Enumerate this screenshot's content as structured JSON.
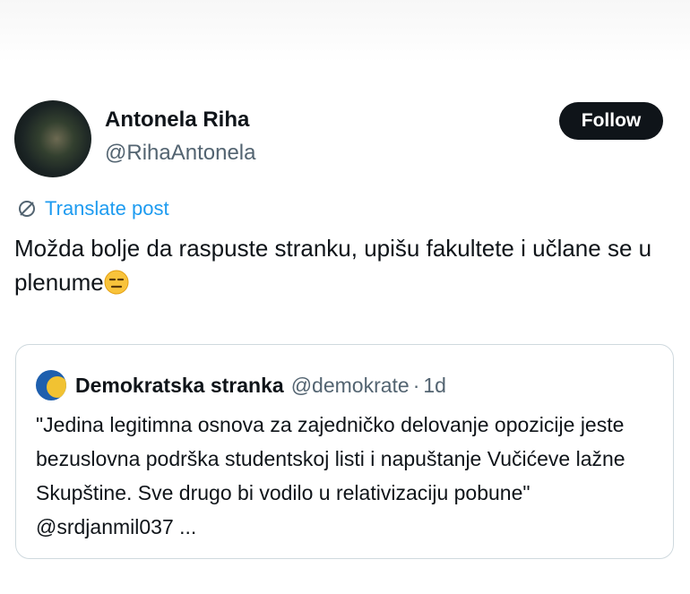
{
  "post": {
    "author": {
      "name": "Antonela Riha",
      "handle": "@RihaAntonela"
    },
    "follow_label": "Follow",
    "translate_label": "Translate post",
    "text": "Možda bolje da raspuste stranku, upišu fakultete i učlane se u plenume",
    "emoji": "expressionless-face"
  },
  "quote": {
    "author_name": "Demokratska stranka",
    "author_handle": "@demokrate",
    "separator": "·",
    "time": "1d",
    "text": "\"Jedina legitimna osnova za zajedničko delovanje opozicije jeste bezuslovna podrška studentskoj listi i napuštanje Vučićeve lažne Skupštine. Sve drugo bi vodilo u relativizaciju pobune\" @srdjanmil037 ..."
  },
  "colors": {
    "accent": "#1d9bf0",
    "text": "#0f1419",
    "secondary_text": "#536471",
    "follow_bg": "#0f1419",
    "border": "#cfd9de"
  }
}
